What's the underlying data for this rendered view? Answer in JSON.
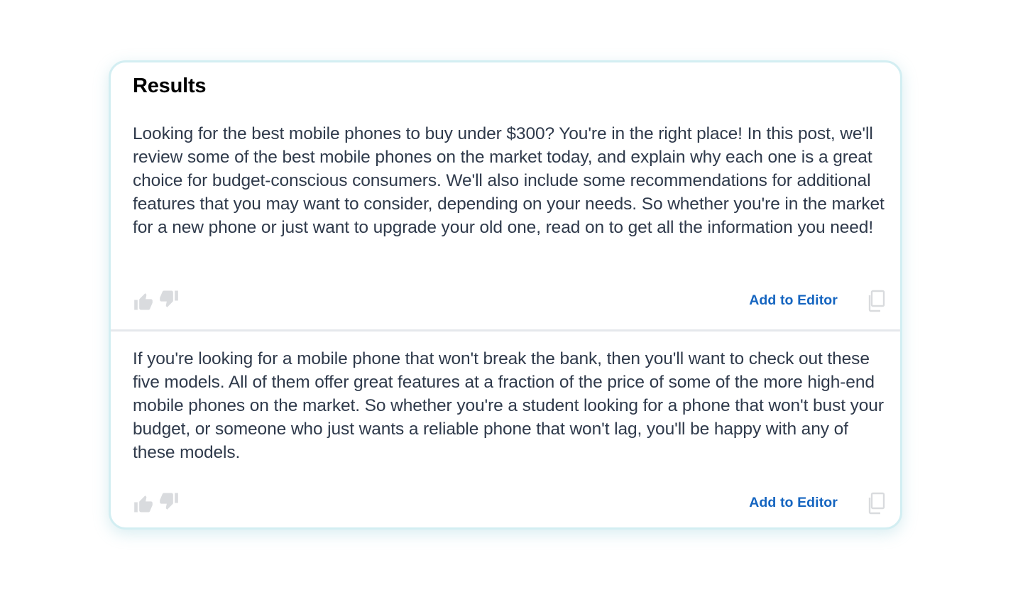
{
  "results_panel": {
    "title": "Results",
    "items": [
      {
        "text": "Looking for the best mobile phones to buy under $300? You're in the right place! In this post, we'll review some of the best mobile phones on the market today, and explain why each one is a great choice for budget-conscious consumers. We'll also include some recommendations for additional features that you may want to consider, depending on your needs. So whether you're in the market for a new phone or just want to upgrade your old one, read on to get all the information you need!",
        "add_label": "Add to Editor"
      },
      {
        "text": "If you're looking for a mobile phone that won't break the bank, then you'll want to check out these five models. All of them offer great features at a fraction of the price of some of the more high-end mobile phones on the market. So whether you're a student looking for a phone that won't bust your budget, or someone who just wants a reliable phone that won't lag, you'll be happy with any of these models.",
        "add_label": "Add to Editor"
      }
    ]
  },
  "colors": {
    "accent_link": "#1565c0",
    "body_text": "#2f3a4b",
    "card_border": "#d3eef2",
    "icon_muted": "#d9dbde"
  },
  "icons": {
    "vote_up": "thumbs-up-icon",
    "vote_down": "thumbs-down-icon",
    "copy": "copy-icon"
  }
}
